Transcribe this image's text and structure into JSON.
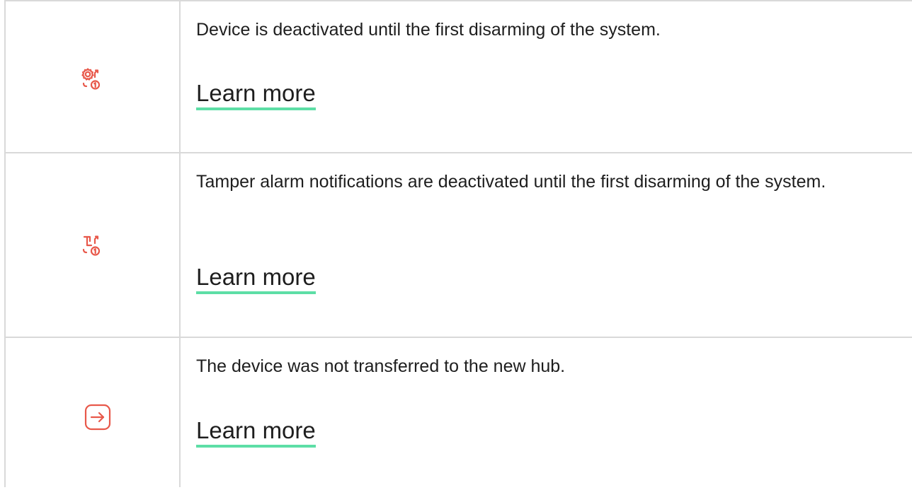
{
  "rows": [
    {
      "icon": "settings-deactivated-until-disarm-icon",
      "description": "Device is deactivated until the first disarming of the system.",
      "link": "Learn more"
    },
    {
      "icon": "tamper-deactivated-until-disarm-icon",
      "description": "Tamper alarm notifications are deactivated until the first disarming of the system.",
      "link": "Learn more"
    },
    {
      "icon": "not-transferred-icon",
      "description": "The device was not transferred to the new hub.",
      "link": "Learn more"
    }
  ],
  "colors": {
    "icon": "#e8584a",
    "link_underline": "#5ddea6",
    "border": "#d9d9d9",
    "text": "#1e1e1e"
  }
}
